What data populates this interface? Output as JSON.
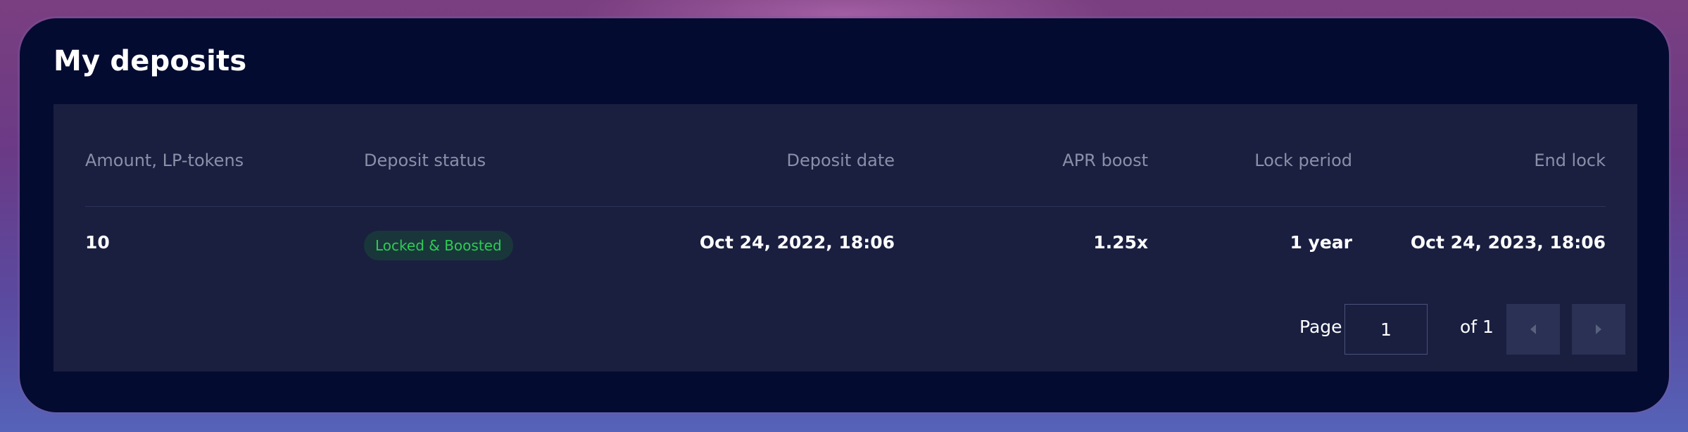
{
  "title": "My deposits",
  "table": {
    "headers": [
      "Amount, LP-tokens",
      "Deposit status",
      "Deposit date",
      "APR boost",
      "Lock period",
      "End lock"
    ],
    "rows": [
      {
        "amount": "10",
        "status": "Locked & Boosted",
        "deposit_date": "Oct 24, 2022, 18:06",
        "apr_boost": "1.25x",
        "lock_period": "1 year",
        "end_lock": "Oct 24, 2023, 18:06"
      }
    ]
  },
  "pagination": {
    "page_label": "Page",
    "page_value": "1",
    "of_label": "of 1",
    "prev_icon": "chevron-left-icon",
    "next_icon": "chevron-right-icon"
  },
  "colors": {
    "background": "#040b30",
    "panel": "#1a1f40",
    "status_text": "#2fcb55",
    "status_bg": "#19373a",
    "header_text": "#8a90a8"
  }
}
